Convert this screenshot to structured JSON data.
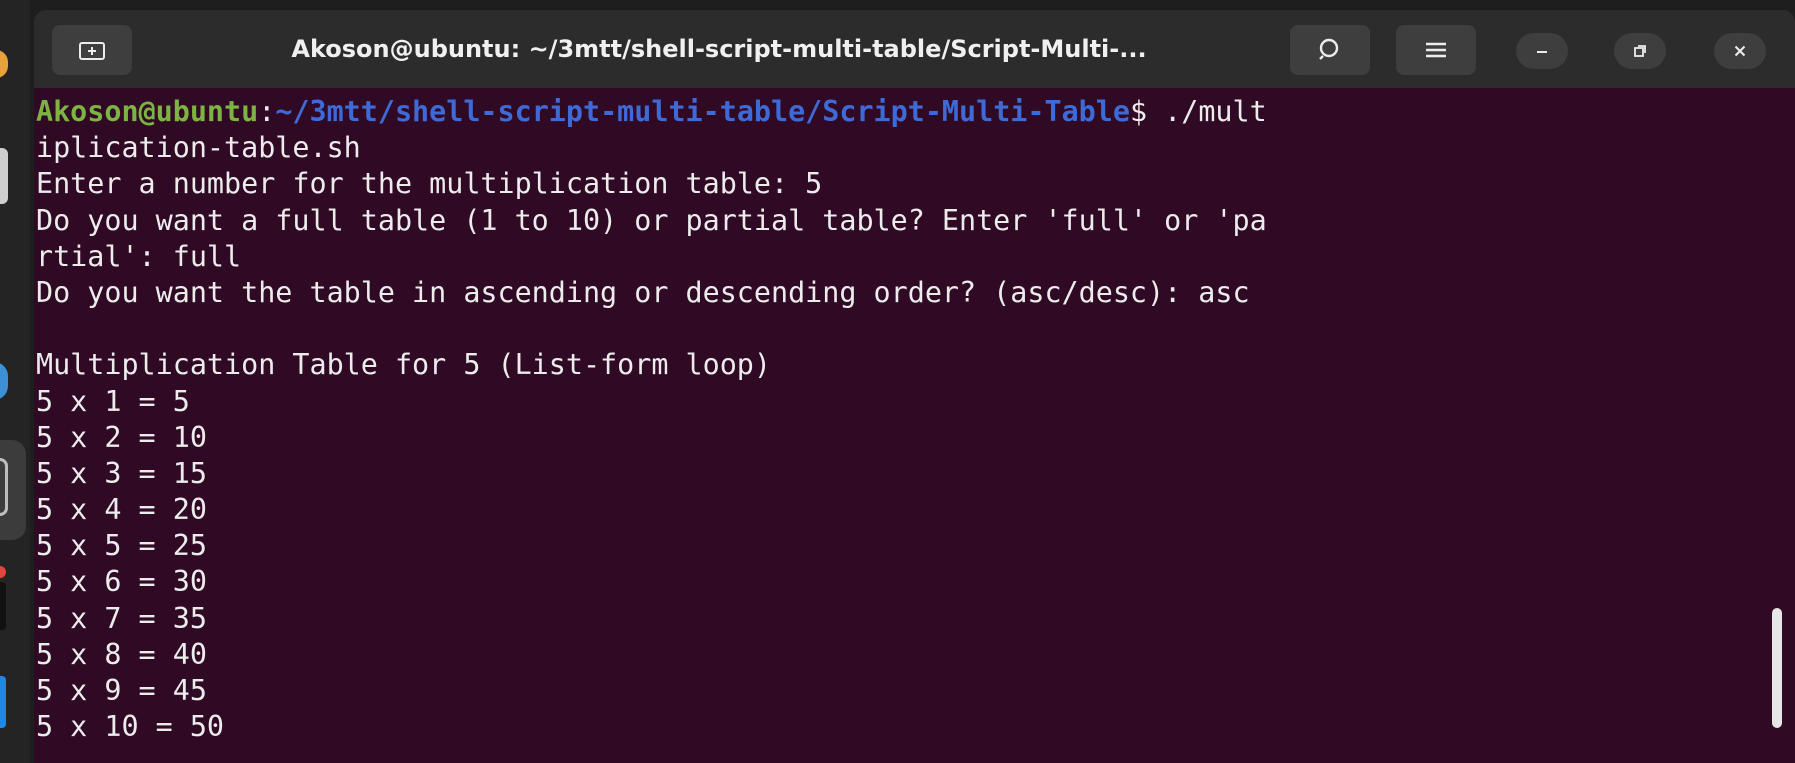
{
  "window": {
    "title": "Akoson@ubuntu: ~/3mtt/shell-script-multi-table/Script-Multi-..."
  },
  "titlebar_icons": {
    "new_tab": "new-tab-icon",
    "search": "search-icon",
    "menu": "hamburger-menu-icon",
    "minimize": "minimize-icon",
    "maximize": "restore-icon",
    "close": "close-icon"
  },
  "terminal": {
    "prompt": {
      "user_host": "Akoson@ubuntu",
      "colon": ":",
      "path": "~/3mtt/shell-script-multi-table/Script-Multi-Table",
      "dollar": "$ ",
      "command_part1": "./mult"
    },
    "lines": [
      "iplication-table.sh",
      "Enter a number for the multiplication table: 5",
      "Do you want a full table (1 to 10) or partial table? Enter 'full' or 'pa",
      "rtial': full",
      "Do you want the table in ascending or descending order? (asc/desc): asc",
      "",
      "Multiplication Table for 5 (List-form loop)",
      "5 x 1 = 5",
      "5 x 2 = 10",
      "5 x 3 = 15",
      "5 x 4 = 20",
      "5 x 5 = 25",
      "5 x 6 = 30",
      "5 x 7 = 35",
      "5 x 8 = 40",
      "5 x 9 = 45",
      "5 x 10 = 50"
    ]
  },
  "colors": {
    "terminal_bg": "#300a24",
    "prompt_user": "#7cb342",
    "prompt_path": "#3d6ad6",
    "text": "#ececec"
  }
}
